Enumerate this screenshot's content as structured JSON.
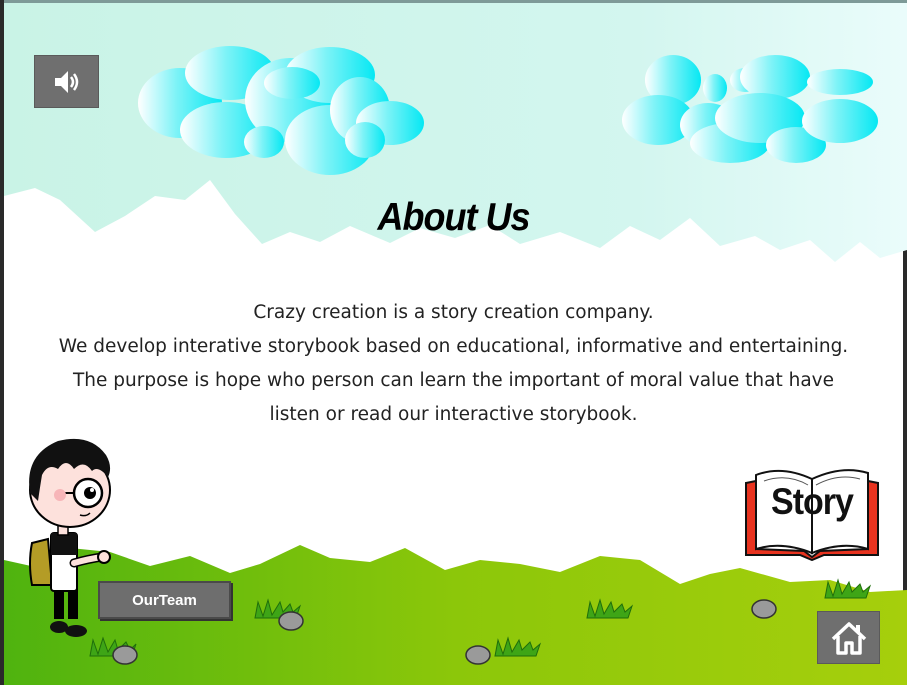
{
  "page": {
    "title": "About Us",
    "paragraph_lines": [
      "Crazy creation is a story creation company.",
      "We develop interative storybook based on educational, informative and entertaining.",
      "The purpose is hope who person can learn the important of moral value that have",
      "listen or read our interactive storybook."
    ]
  },
  "buttons": {
    "sound_icon": "speaker-icon",
    "team_label": "OurTeam",
    "story_label": "Story",
    "home_icon": "home-icon"
  },
  "colors": {
    "sky": "#cdf5ee",
    "cloud": "#0ae6f2",
    "grass": "#5cbb13",
    "button_gray": "#6f6f6f",
    "book_red": "#e8331f"
  }
}
